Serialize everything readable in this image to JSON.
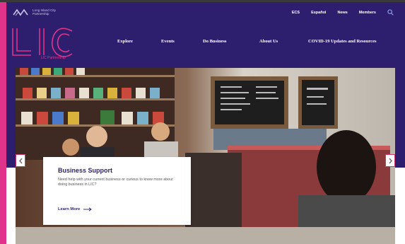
{
  "brand": {
    "tagline": "Long Island City Partnership",
    "logo_text": "LIC",
    "logo_sub": "LIC Partnership"
  },
  "utility_nav": [
    "ECS",
    "Español",
    "News",
    "Members"
  ],
  "main_nav": [
    "Explore",
    "Events",
    "Do Business",
    "About Us",
    "COVID-19 Updates and Resources"
  ],
  "hero_card": {
    "title": "Business Support",
    "body": "Need help with your current business or curious to know more about doing business in LIC?",
    "link": "Learn More"
  },
  "colors": {
    "header_bg": "#2e1f6e",
    "accent_pink": "#e0338a",
    "card_title": "#2e1f6e"
  },
  "icons": [
    "wave-logo-icon",
    "search-icon",
    "chevron-left-icon",
    "chevron-right-icon",
    "arrow-right-icon"
  ]
}
